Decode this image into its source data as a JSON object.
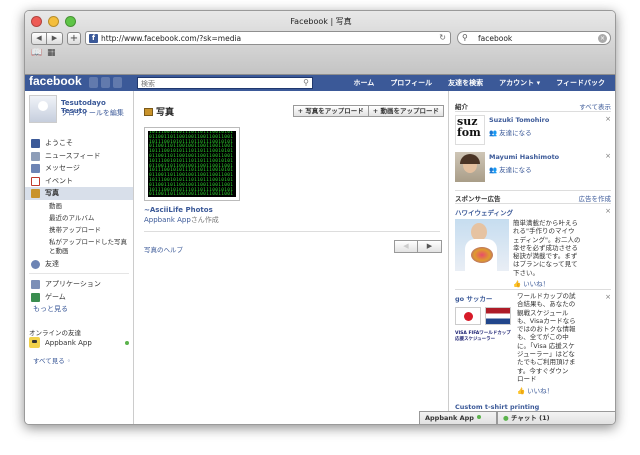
{
  "window": {
    "title": "Facebook | 写真"
  },
  "browser": {
    "back": "◀",
    "forward": "▶",
    "add": "+",
    "url": "http://www.facebook.com/?sk=media",
    "search_value": "facebook",
    "reload": "↻"
  },
  "fb": {
    "logo": "facebook",
    "search_placeholder": "検索",
    "nav": [
      "ホーム",
      "プロフィール",
      "友達を検索",
      "アカウント ▾",
      "フィードバック"
    ]
  },
  "user": {
    "name": "Tesutodayo Tesuto",
    "edit": "プロフィールを編集"
  },
  "sidebar": {
    "items": [
      {
        "label": "ようこそ",
        "icon": "facebook-icon",
        "color": "#3b5998"
      },
      {
        "label": "ニュースフィード",
        "icon": "news-feed-icon",
        "color": "#8d9db8"
      },
      {
        "label": "メッセージ",
        "icon": "messages-icon",
        "color": "#6d84b4"
      },
      {
        "label": "イベント",
        "icon": "events-icon",
        "color": "#c0392b"
      },
      {
        "label": "写真",
        "icon": "photos-icon",
        "color": "#c9932b"
      }
    ],
    "photo_sub": [
      "動画",
      "最近のアルバム",
      "携帯アップロード"
    ],
    "photo_sub_long": "私がアップロードした写真と動画",
    "friends": "友達",
    "apps": [
      {
        "label": "アプリケーション",
        "icon": "apps-icon",
        "color": "#7c8fb7"
      },
      {
        "label": "ゲーム",
        "icon": "games-icon",
        "color": "#3a8d4f"
      }
    ],
    "more": "もっと見る",
    "online_title": "オンラインの友達",
    "online_user": "Appbank App",
    "see_all": "すべて見る ◦"
  },
  "main": {
    "title": "写真",
    "upload_photo": "+ 写真をアップロード",
    "upload_video": "+ 動画をアップロード",
    "album_title": "~AsciiLife Photos",
    "album_owner": "Appbank App",
    "album_owner_suffix": "さん作成",
    "help": "写真のヘルプ",
    "prev": "◀",
    "next": "▶"
  },
  "right": {
    "intro_title": "紹介",
    "see_all": "すべて表示",
    "suggestions": [
      {
        "name": "Suzuki Tomohiro",
        "action": "友達になる"
      },
      {
        "name": "Mayumi Hashimoto",
        "action": "友達になる"
      }
    ],
    "sponsor_title": "スポンサー広告",
    "create_ad": "広告を作成",
    "ads": [
      {
        "title": "ハワイウェディング",
        "text": [
          "簡単満載だから叶えら",
          "れる\"手作りのマイウ",
          "ェディング\"。お二人の",
          "幸せを必ず成功させる",
          "秘訣が満載です。まず",
          "はプランになって見て",
          "下さい。"
        ],
        "like": "いいね！"
      },
      {
        "title": "go サッカー",
        "text": [
          "ワールドカップの試",
          "合結果も、あなたの",
          "観戦スケジュール",
          "も、Visaカードなら",
          "ではのおトクな情報",
          "も、全てがこの中",
          "に。「Visa 応援スケ",
          "ジューラー」はどな",
          "たでもご利用頂けま",
          "す。今すぐダウン",
          "ロード"
        ],
        "like": "いいね！",
        "banner": "VISA FIFAワールドカップ 応援スケジューラー"
      },
      {
        "title": "Custom t-shirt printing"
      }
    ]
  },
  "chat": {
    "user": "Appbank App",
    "label": "チャット (1)"
  }
}
